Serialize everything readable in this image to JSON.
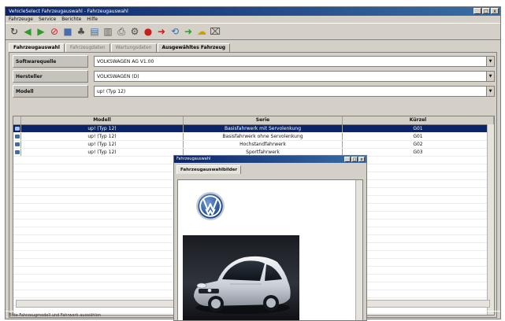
{
  "app": {
    "title": "VehicleSelect Fahrzeugauswahl - Fahrzeugauswahl",
    "controls": {
      "minimize": "_",
      "maximize": "□",
      "close": "x"
    }
  },
  "menu": {
    "items": [
      "Fahrzeuge",
      "Service",
      "Berichte",
      "Hilfe"
    ]
  },
  "toolbar": {
    "icons": [
      {
        "name": "refresh-icon",
        "glyph": "↻",
        "color": "#303030"
      },
      {
        "name": "back-arrow-icon",
        "glyph": "◀",
        "color": "#2f9a2f"
      },
      {
        "name": "forward-arrow-icon",
        "glyph": "▶",
        "color": "#2f9a2f"
      },
      {
        "name": "stop-icon",
        "glyph": "⊘",
        "color": "#cc2020"
      },
      {
        "name": "stop-small-icon",
        "glyph": "■",
        "color": "#4b6ea8"
      },
      {
        "name": "tool-icon",
        "glyph": "♣",
        "color": "#505050"
      },
      {
        "name": "document-icon",
        "glyph": "▤",
        "color": "#3a6ea5"
      },
      {
        "name": "page-icon",
        "glyph": "▥",
        "color": "#5a5a5a"
      },
      {
        "name": "print-icon",
        "glyph": "⎙",
        "color": "#505050"
      },
      {
        "name": "settings-icon",
        "glyph": "⚙",
        "color": "#4a4a4a"
      },
      {
        "name": "record-icon",
        "glyph": "●",
        "color": "#c81e1e"
      },
      {
        "name": "red-arrow-icon",
        "glyph": "➜",
        "color": "#c81e1e"
      },
      {
        "name": "cycle-icon",
        "glyph": "⟲",
        "color": "#3a6ea5"
      },
      {
        "name": "green-arrow-icon",
        "glyph": "➜",
        "color": "#2f9a2f"
      },
      {
        "name": "cloud-icon",
        "glyph": "☁",
        "color": "#c8a000"
      },
      {
        "name": "trash-icon",
        "glyph": "⌧",
        "color": "#505050"
      }
    ]
  },
  "tabs": [
    {
      "label": "Fahrzeugauswahl",
      "state": "active"
    },
    {
      "label": "Fahrzeugdaten",
      "state": "disabled"
    },
    {
      "label": "Wartungsdaten",
      "state": "disabled"
    },
    {
      "label": "Ausgewähltes Fahrzeug",
      "state": "strong"
    }
  ],
  "filters": [
    {
      "label": "Softwarequelle",
      "value": "VOLKSWAGEN AG V1.00"
    },
    {
      "label": "Hersteller",
      "value": "VOLKSWAGEN (D)"
    },
    {
      "label": "Modell",
      "value": "up! (Typ 12)"
    }
  ],
  "table": {
    "headers": [
      "",
      "Modell",
      "Serie",
      "Kürzel"
    ],
    "rows": [
      {
        "modell": "up! (Typ 12)",
        "serie": "Basisfahrwerk mit Servolenkung",
        "kuerzel": "G01",
        "selected": true
      },
      {
        "modell": "up! (Typ 12)",
        "serie": "Basisfahrwerk ohne Servolenkung",
        "kuerzel": "G01",
        "selected": false
      },
      {
        "modell": "up! (Typ 12)",
        "serie": "Hochstandfahrwerk",
        "kuerzel": "G02",
        "selected": false
      },
      {
        "modell": "up! (Typ 12)",
        "serie": "Sportfahrwerk",
        "kuerzel": "G03",
        "selected": false
      }
    ]
  },
  "status": {
    "text": "Bitte Fahrzeugmodell und Fahrwerk auswählen"
  },
  "popup": {
    "title": "Fahrzeugauswahl",
    "tab": "Fahrzeugauswahlbilder",
    "controls": {
      "minimize": "_",
      "maximize": "□",
      "close": "x"
    }
  },
  "colors": {
    "selection": "#0a246a",
    "window": "#d4d0c8",
    "titlebar": "#0a246a"
  }
}
